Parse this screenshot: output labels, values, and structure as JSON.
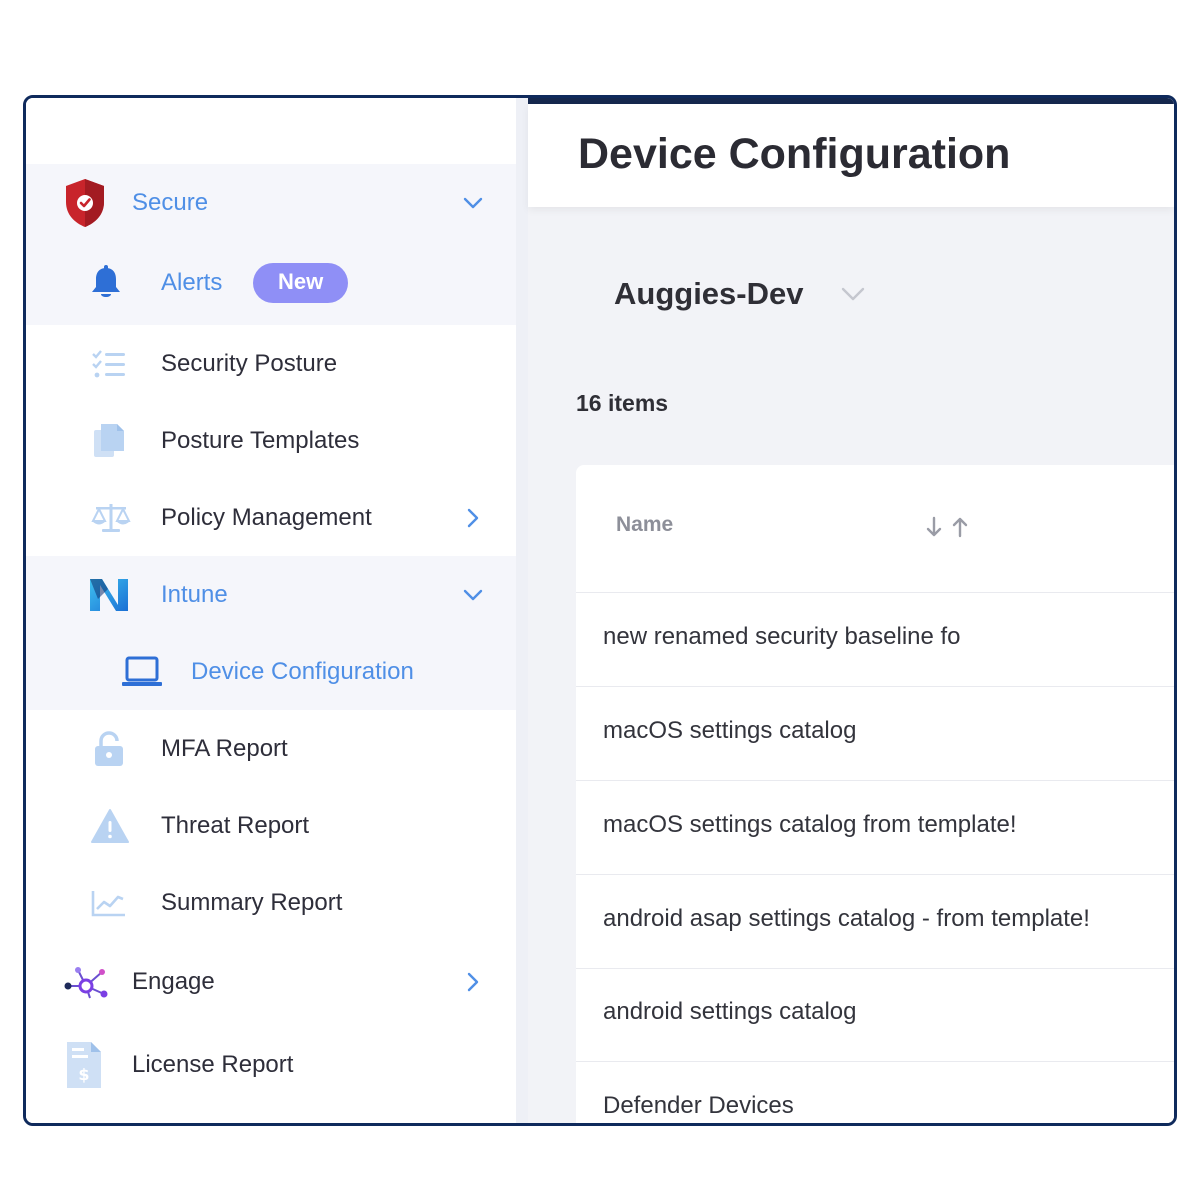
{
  "main": {
    "title": "Device Configuration",
    "tenant": "Auggies-Dev",
    "item_count": "16 items",
    "table": {
      "column_name": "Name",
      "rows": [
        "new renamed security baseline fo",
        "macOS settings catalog",
        "macOS settings catalog from template!",
        "android asap settings catalog - from template!",
        "android settings catalog",
        "Defender Devices"
      ]
    }
  },
  "sidebar": {
    "secure": "Secure",
    "alerts": "Alerts",
    "alerts_badge": "New",
    "security_posture": "Security Posture",
    "posture_templates": "Posture Templates",
    "policy_management": "Policy Management",
    "intune": "Intune",
    "device_configuration": "Device Configuration",
    "mfa_report": "MFA Report",
    "threat_report": "Threat Report",
    "summary_report": "Summary Report",
    "engage": "Engage",
    "license_report": "License Report"
  },
  "colors": {
    "accent_blue": "#4f8fe6",
    "badge": "#8f8ff6",
    "shield_red": "#c8242b",
    "frame": "#0f2a5c"
  },
  "icons": [
    "shield-icon",
    "bell-icon",
    "checklist-icon",
    "documents-icon",
    "scales-icon",
    "intune-icon",
    "laptop-icon",
    "lock-icon",
    "warning-icon",
    "chart-icon",
    "network-icon",
    "invoice-icon",
    "chevron-down-icon",
    "chevron-right-icon",
    "sort-icon"
  ]
}
